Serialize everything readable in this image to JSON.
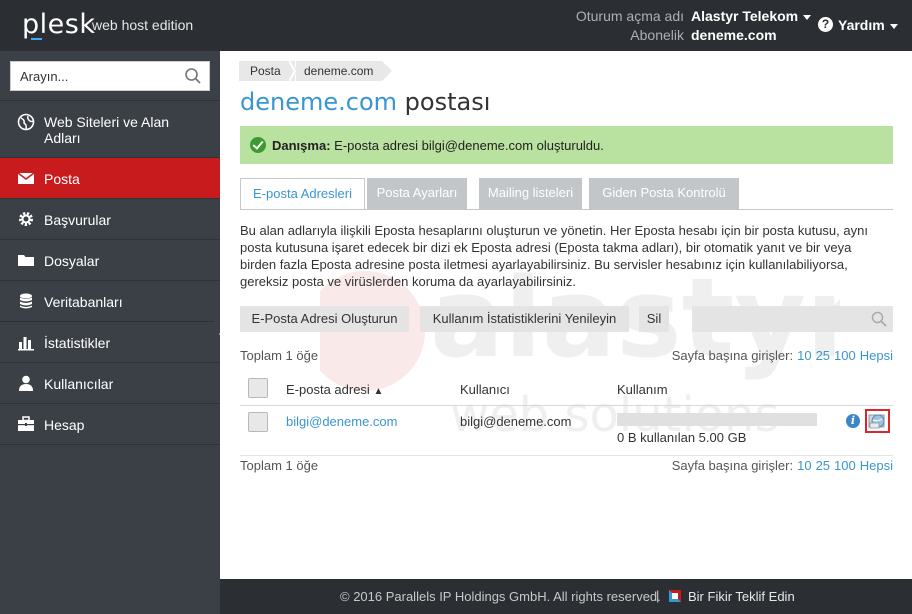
{
  "header": {
    "logo": "plesk",
    "edition": "web host edition",
    "login_label": "Oturum açma adı",
    "login_value": "Alastyr Telekom",
    "subscription_label": "Abonelik",
    "subscription_value": "deneme.com",
    "help_label": "Yardım"
  },
  "sidebar": {
    "search_placeholder": "Arayın...",
    "items": [
      {
        "label_line1": "Web Siteleri ve Alan",
        "label_line2": "Adları",
        "icon": "globe-icon"
      },
      {
        "label": "Posta",
        "icon": "envelope-icon",
        "active": true
      },
      {
        "label": "Başvurular",
        "icon": "gear-icon"
      },
      {
        "label": "Dosyalar",
        "icon": "folder-icon"
      },
      {
        "label": "Veritabanları",
        "icon": "database-icon"
      },
      {
        "label": "İstatistikler",
        "icon": "bar-chart-icon"
      },
      {
        "label": "Kullanıcılar",
        "icon": "user-icon"
      },
      {
        "label": "Hesap",
        "icon": "briefcase-icon"
      }
    ]
  },
  "breadcrumb": [
    "Posta",
    "deneme.com"
  ],
  "page": {
    "title_domain": "deneme.com",
    "title_rest": "postası"
  },
  "message": {
    "label": "Danışma:",
    "text": "E-posta adresi bilgi@deneme.com oluşturuldu."
  },
  "tabs": [
    {
      "label": "E-posta Adresleri",
      "active": true
    },
    {
      "label": "Posta Ayarları"
    },
    {
      "label": "Mailing listeleri"
    },
    {
      "label": "Giden Posta Kontrolü"
    }
  ],
  "description": "Bu alan adlarıyla ilişkili Eposta hesaplarını oluşturun ve yönetin. Her Eposta hesabı için bir posta kutusu, aynı posta kutusuna işaret edecek bir dizi ek Eposta adresi (Eposta takma adları), bir otomatik yanıt ve bir veya birden fazla Eposta adresine posta iletmesi ayarlayabilirsiniz. Bu servisler hesabınız için kullanılabiliyorsa, gereksiz posta ve virüslerden koruma da ayarlayabilirsiniz.",
  "toolbar": {
    "create_label": "E-Posta Adresi Oluşturun",
    "refresh_label": "Kullanım İstatistiklerini Yenileyin",
    "delete_label": "Sil"
  },
  "list": {
    "total_top": "Toplam 1 öğe",
    "total_bottom": "Toplam 1 öğe",
    "per_page_label": "Sayfa başına girişler:",
    "per_page_options": [
      "10",
      "25",
      "100",
      "Hepsi"
    ],
    "columns": [
      "E-posta adresi",
      "Kullanıcı",
      "Kullanım"
    ],
    "sort_indicator": "▲",
    "rows": [
      {
        "email": "bilgi@deneme.com",
        "user": "bilgi@deneme.com",
        "usage_text": "0 B kullanılan 5.00 GB",
        "usage_fraction": 0
      }
    ]
  },
  "watermark": {
    "brand": "alastyr",
    "tagline": "web solutions"
  },
  "footer": {
    "copyright": "© 2016 Parallels IP Holdings GmbH. All rights reserved.",
    "separator": "|",
    "feedback": "Bir Fikir Teklif Edin"
  },
  "colors": {
    "accent": "#3a96d0",
    "active_nav": "#c81b1e",
    "success": "#b9e1a0",
    "header_bg": "#2b2f33",
    "sidebar_bg": "#3a4046"
  }
}
